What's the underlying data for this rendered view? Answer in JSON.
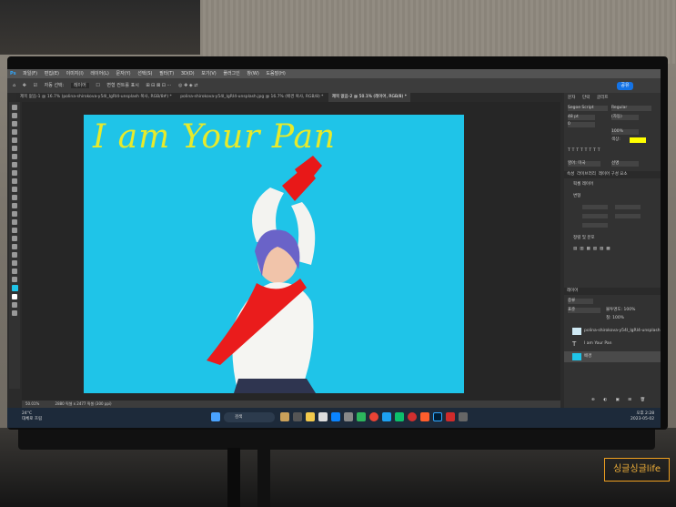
{
  "menubar": {
    "items": [
      "파일(F)",
      "편집(E)",
      "이미지(I)",
      "레이어(L)",
      "문자(Y)",
      "선택(S)",
      "필터(T)",
      "3D(D)",
      "보기(V)",
      "플러그인",
      "창(W)",
      "도움말(H)"
    ]
  },
  "optbar": {
    "auto_select": "자동 선택:",
    "layer_select": "레이어",
    "transform": "변형 컨트롤 표시",
    "share": "공유"
  },
  "tabs": [
    {
      "label": "제목 없음-1 @ 16.7% (polina-shirokova-y54l_IgRI4-unsplash 복사, RGB/8#) *"
    },
    {
      "label": "polina-shirokova-y54l_IgRI4-unsplash.jpg @ 16.7% (배경 복사, RGB/8) *"
    },
    {
      "label": "제목 없음-2 @ 50.1% (레이어, RGB/8) *"
    }
  ],
  "document": {
    "text": "I am Your Pan",
    "bg_color": "#1fc4e8",
    "text_color": "#e7ea2b"
  },
  "statusbar": {
    "zoom": "50.01%",
    "size": "2880 픽셀 x 2477 픽셀 (300 ppi)"
  },
  "panels": {
    "tabs": [
      "문자",
      "단락",
      "글리프"
    ],
    "font": "Segoe Script",
    "style": "Regular",
    "size": "48 pt",
    "leading": "(자동)",
    "tracking": "0",
    "scale": "100%",
    "color_label": "색상:",
    "color": "#ffff00",
    "lang": "영어: 미국",
    "aa": "선명",
    "props_tabs": [
      "속성",
      "라이브러리",
      "레이어 구성 요소"
    ],
    "props_title": "픽셀 레이어",
    "transform_label": "변형",
    "align_label": "정렬 및 분포",
    "layers_title": "레이어",
    "layers_kind": "종류",
    "blend": "표준",
    "opacity": "불투명도: 100%",
    "fill": "칠: 100%",
    "layers": [
      {
        "name": "polina-shirokova-y54l_IgRI4-unsplash",
        "kind": "image"
      },
      {
        "name": "I am Your Pan",
        "kind": "text"
      },
      {
        "name": "배경",
        "kind": "fill"
      }
    ]
  },
  "taskbar": {
    "temp": "24°C",
    "weather": "대체로 흐림",
    "search": "검색",
    "time": "오후 2:28",
    "date": "2023-05-02"
  },
  "watermark": "싱글싱글life"
}
